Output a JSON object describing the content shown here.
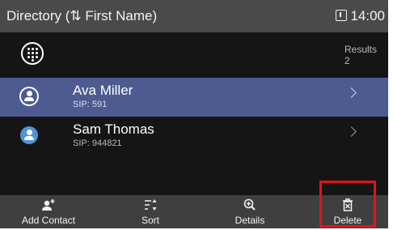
{
  "titlebar": {
    "title": "Directory (⇅ First Name)",
    "time": "14:00",
    "status_icon": "clock-icon"
  },
  "search": {
    "keypad_icon": "dialpad-icon"
  },
  "results": {
    "label": "Results",
    "count": "2"
  },
  "contacts": [
    {
      "name": "Ava Miller",
      "sip": "SIP: 591",
      "selected": true
    },
    {
      "name": "Sam Thomas",
      "sip": "SIP: 944821",
      "selected": false
    }
  ],
  "softkeys": {
    "add_contact": "Add Contact",
    "sort": "Sort",
    "details": "Details",
    "delete": "Delete"
  },
  "colors": {
    "selected_row": "#4e5b91",
    "avatar": "#4f94d8",
    "highlight": "#e0141b"
  }
}
